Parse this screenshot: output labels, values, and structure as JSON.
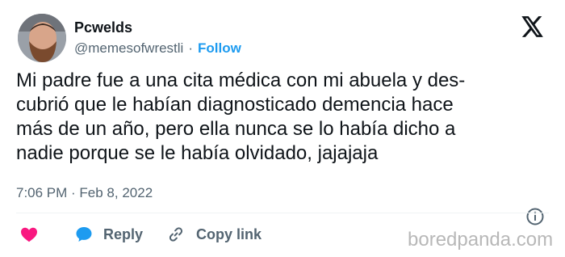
{
  "header": {
    "display_name": "Pcwelds",
    "handle": "@memesofwrestli",
    "separator": "·",
    "follow_label": "Follow"
  },
  "tweet": {
    "lines": [
      "Mi padre fue a una cita médica con mi abuela y des-",
      "cubrió que le habían diagnosticado demencia hace",
      "más de un año, pero ella nunca se lo había dicho a",
      "nadie porque se le había olvidado, jajajaja"
    ],
    "timestamp": "7:06 PM · Feb 8, 2022"
  },
  "actions": {
    "like_icon": "heart-icon",
    "reply_label": "Reply",
    "reply_icon": "speech-bubble-icon",
    "copy_label": "Copy link",
    "copy_icon": "link-icon"
  },
  "icons": {
    "x_logo": "x-logo-icon",
    "info": "info-icon"
  },
  "watermark": "boredpanda.com",
  "colors": {
    "text": "#0f1419",
    "muted": "#536471",
    "accent": "#1d9bf0",
    "like": "#f91880",
    "reply": "#1d9bf0",
    "watermark": "#b8b8b8"
  }
}
